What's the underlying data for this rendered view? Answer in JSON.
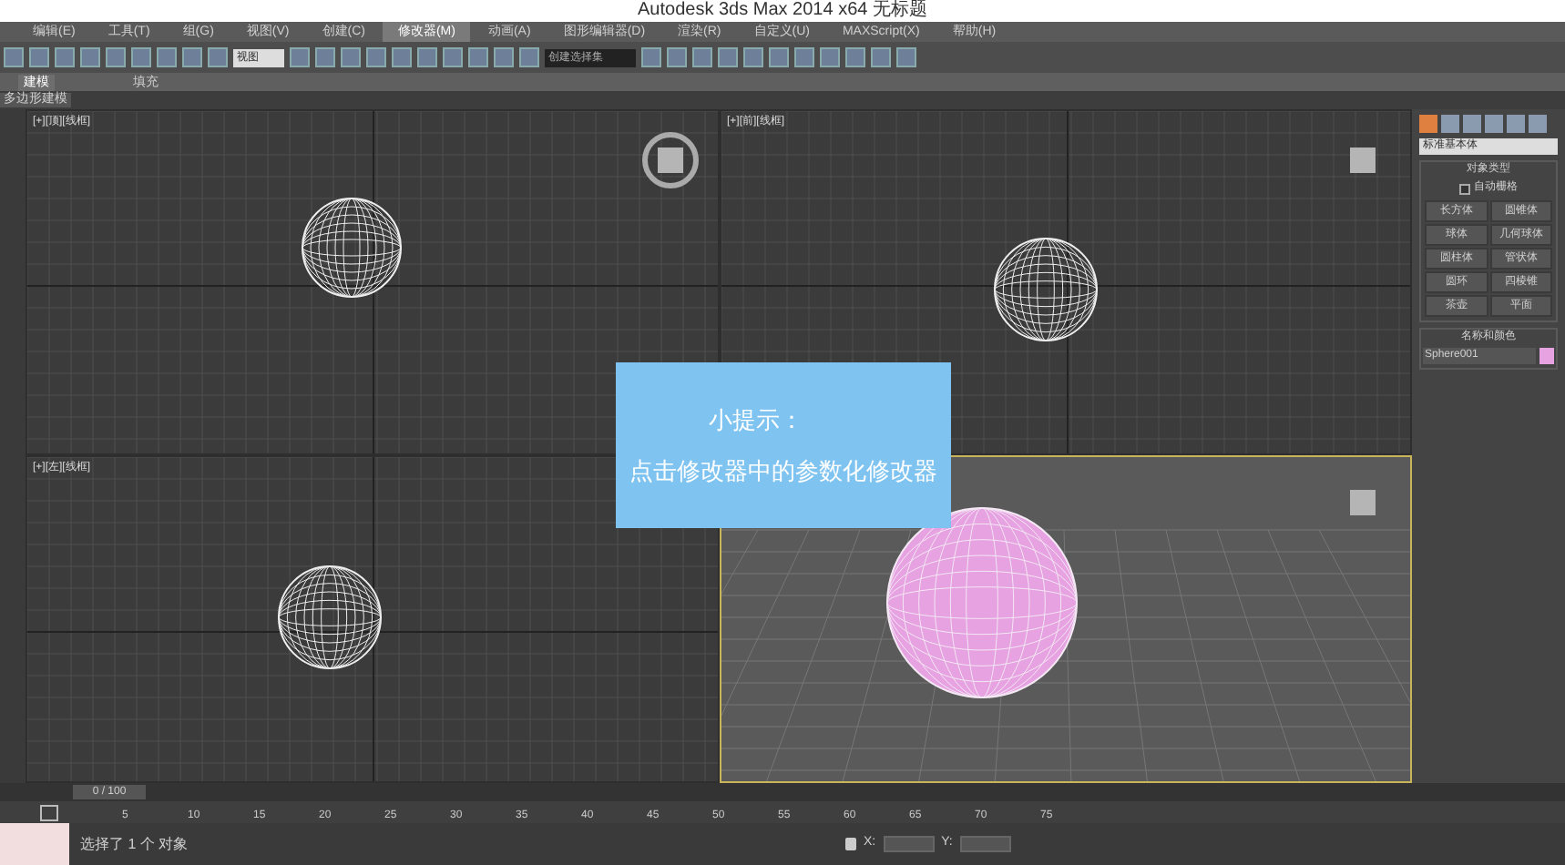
{
  "window": {
    "title": "Autodesk 3ds Max 2014 x64   无标题"
  },
  "menu": [
    {
      "label": "编辑(E)",
      "selected": false
    },
    {
      "label": "工具(T)",
      "selected": false
    },
    {
      "label": "组(G)",
      "selected": false
    },
    {
      "label": "视图(V)",
      "selected": false
    },
    {
      "label": "创建(C)",
      "selected": false
    },
    {
      "label": "修改器(M)",
      "selected": true
    },
    {
      "label": "动画(A)",
      "selected": false
    },
    {
      "label": "图形编辑器(D)",
      "selected": false
    },
    {
      "label": "渲染(R)",
      "selected": false
    },
    {
      "label": "自定义(U)",
      "selected": false
    },
    {
      "label": "MAXScript(X)",
      "selected": false
    },
    {
      "label": "帮助(H)",
      "selected": false
    }
  ],
  "toolbar": {
    "view_dropdown": "视图",
    "selection_set": "创建选择集"
  },
  "ribbon": {
    "tabs": [
      {
        "label": "建模",
        "selected": true
      },
      {
        "label": "填充",
        "selected": false
      }
    ],
    "panel": "多边形建模"
  },
  "viewports": [
    {
      "label": "[+][顶][线框]",
      "kind": "top",
      "selected": false
    },
    {
      "label": "[+][前][线框]",
      "kind": "front",
      "selected": false
    },
    {
      "label": "[+][左][线框]",
      "kind": "left",
      "selected": false
    },
    {
      "kind": "perspective",
      "selected": true
    }
  ],
  "tip": {
    "title": "小提示：",
    "text": "点击修改器中的参数化修改器"
  },
  "command_panel": {
    "category": "标准基本体",
    "object_type": {
      "title": "对象类型",
      "autogrid": {
        "label": "自动栅格",
        "checked": false
      },
      "buttons": [
        "长方体",
        "圆锥体",
        "球体",
        "几何球体",
        "圆柱体",
        "管状体",
        "圆环",
        "四棱锥",
        "茶壶",
        "平面"
      ]
    },
    "name_color": {
      "title": "名称和颜色",
      "name": "Sphere001",
      "color": "#e7a2e2"
    }
  },
  "timeline": {
    "position": "0 / 100",
    "level": 0,
    "ticks": [
      "5",
      "10",
      "15",
      "20",
      "25",
      "30",
      "35",
      "40",
      "45",
      "50",
      "55",
      "60",
      "65",
      "70",
      "75"
    ]
  },
  "status_bar": {
    "message": "选择了 1 个 对象",
    "x_label": "X:",
    "y_label": "Y:"
  }
}
